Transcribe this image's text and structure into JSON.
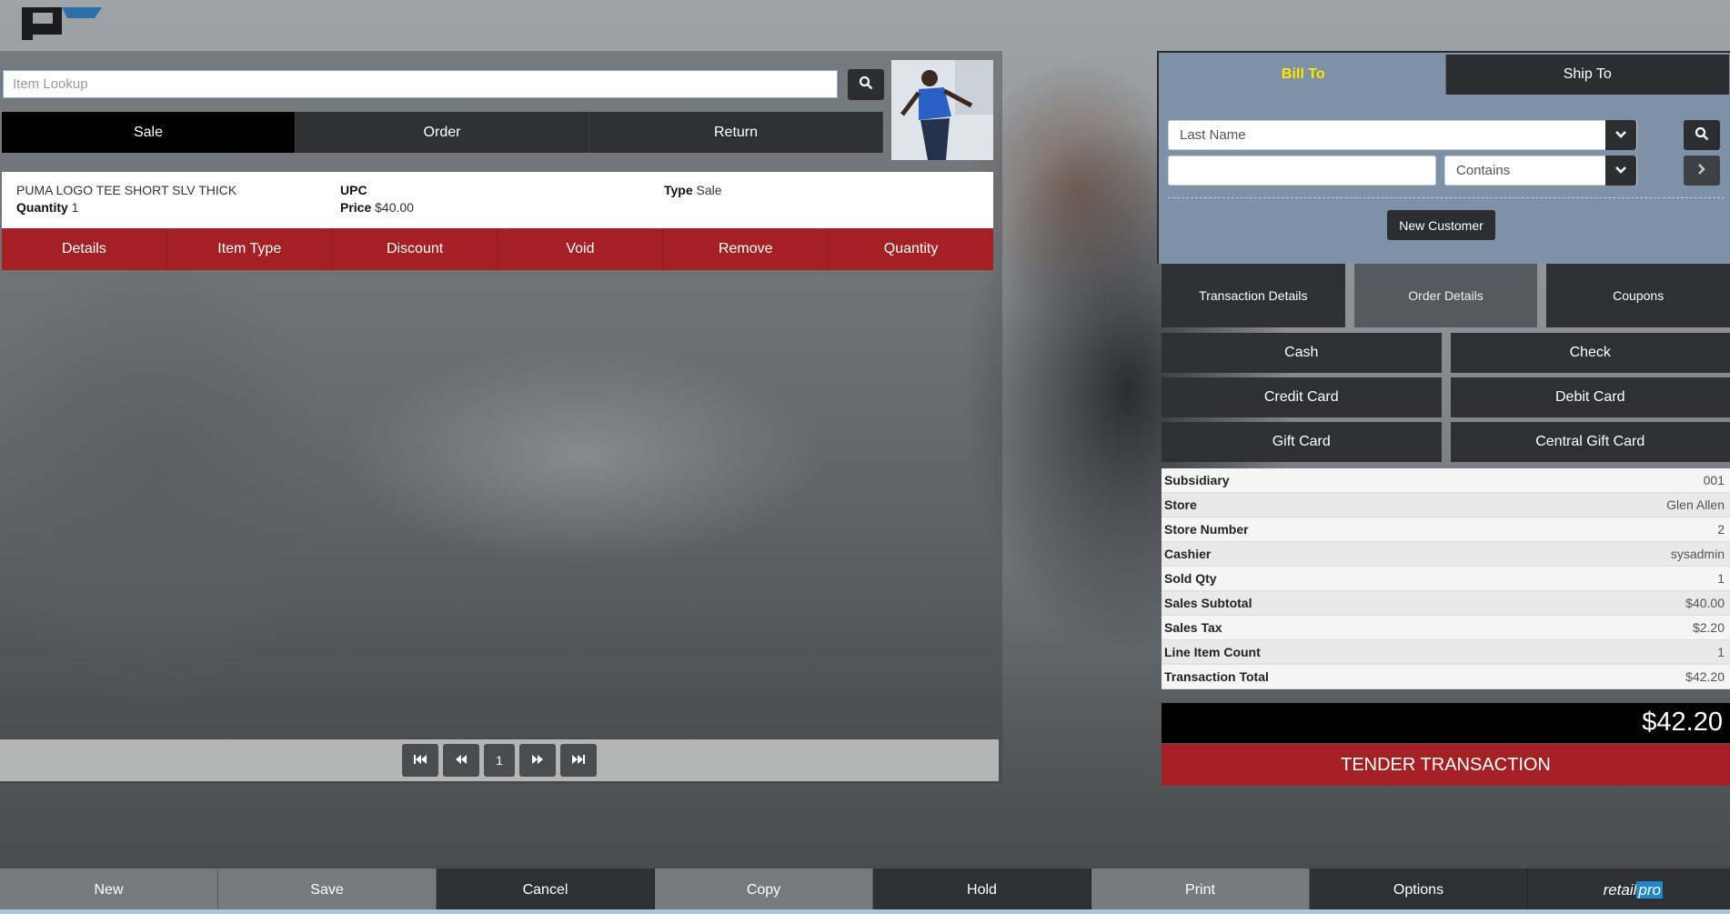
{
  "lookup": {
    "placeholder": "Item Lookup"
  },
  "mode_tabs": [
    {
      "label": "Sale",
      "active": true
    },
    {
      "label": "Order",
      "active": false
    },
    {
      "label": "Return",
      "active": false
    }
  ],
  "item": {
    "name": "PUMA LOGO TEE SHORT SLV THICK",
    "quantity_label": "Quantity",
    "quantity": "1",
    "upc_label": "UPC",
    "upc": "",
    "price_label": "Price",
    "price": "$40.00",
    "type_label": "Type",
    "type": "Sale"
  },
  "item_actions": [
    "Details",
    "Item Type",
    "Discount",
    "Void",
    "Remove",
    "Quantity"
  ],
  "pager": {
    "page": "1"
  },
  "customer": {
    "tabs": [
      {
        "label": "Bill To",
        "active": true
      },
      {
        "label": "Ship To",
        "active": false
      }
    ],
    "search_field_placeholder": "Last Name",
    "match_mode": "Contains",
    "new_customer_label": "New Customer"
  },
  "detail_tabs": [
    "Transaction Details",
    "Order Details",
    "Coupons"
  ],
  "tender_types": [
    "Cash",
    "Check",
    "Credit Card",
    "Debit Card",
    "Gift Card",
    "Central Gift Card"
  ],
  "summary": [
    {
      "label": "Subsidiary",
      "value": "001"
    },
    {
      "label": "Store",
      "value": "Glen Allen"
    },
    {
      "label": "Store Number",
      "value": "2"
    },
    {
      "label": "Cashier",
      "value": "sysadmin"
    },
    {
      "label": "Sold Qty",
      "value": "1"
    },
    {
      "label": "Sales Subtotal",
      "value": "$40.00"
    },
    {
      "label": "Sales Tax",
      "value": "$2.20"
    },
    {
      "label": "Line Item Count",
      "value": "1"
    },
    {
      "label": "Transaction Total",
      "value": "$42.20"
    }
  ],
  "total": "$42.20",
  "tender_label": "TENDER TRANSACTION",
  "bottom_bar": [
    "New",
    "Save",
    "Cancel",
    "Copy",
    "Hold",
    "Print",
    "Options"
  ],
  "brand": {
    "part1": "retail",
    "part2": "pro"
  },
  "colors": {
    "accent_red": "#a52024",
    "customer_panel": "#7f91a7",
    "active_tab_text": "#ffe500"
  }
}
